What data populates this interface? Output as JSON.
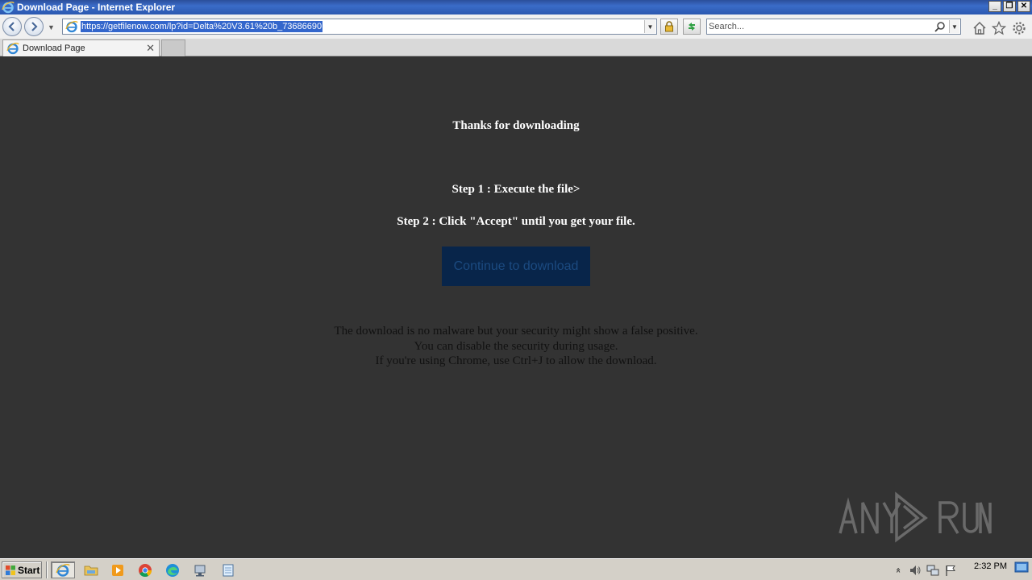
{
  "window": {
    "title": "Download Page - Internet Explorer",
    "controls": [
      "minimize",
      "restore",
      "close"
    ]
  },
  "navbar": {
    "url": "https://getfilenow.com/lp?id=Delta%20V3.61%20b_73686690",
    "search_placeholder": "Search..."
  },
  "tabs": [
    {
      "label": "Download Page",
      "active": true
    }
  ],
  "page": {
    "heading": "Thanks for downloading",
    "step1": "Step 1 : Execute the file>",
    "step2": "Step 2 : Click \"Accept\" until you get your file.",
    "button_label": "Continue to download",
    "notice": [
      "The download is no malware but your security might show a false positive.",
      "You can disable the security during usage.",
      "If you're using Chrome, use Ctrl+J to allow the download."
    ]
  },
  "watermark": {
    "text": "ANY RUN"
  },
  "taskbar": {
    "start_label": "Start",
    "apps": [
      "internet-explorer-icon",
      "folder-icon",
      "media-player-icon",
      "chrome-icon",
      "edge-icon",
      "network-app-icon",
      "notepad-icon"
    ],
    "clock": "2:32 PM"
  },
  "colors": {
    "page_bg": "#333333",
    "button_bg": "#08254a",
    "button_text": "#1b4a80",
    "title_bar": "#2b4f9a"
  }
}
